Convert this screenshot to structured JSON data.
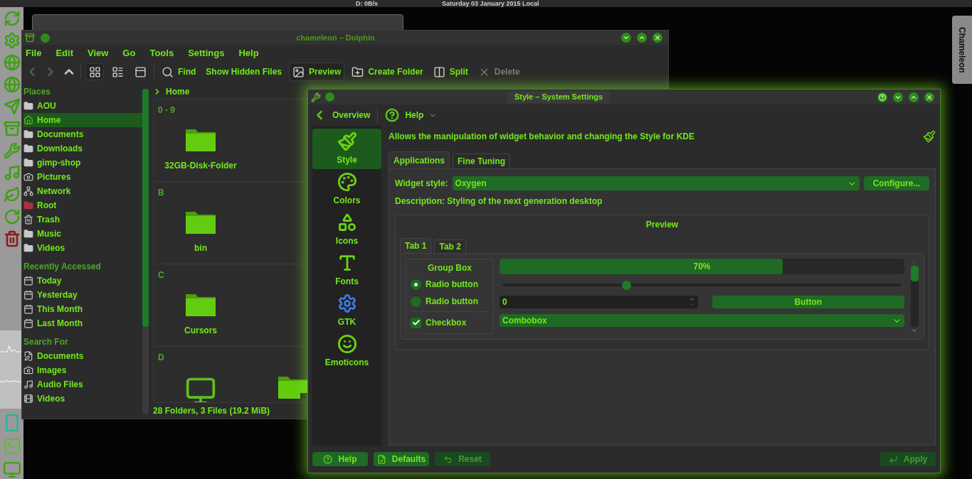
{
  "top_panel": {
    "network_speed": "D: 0B/s",
    "clock": "Saturday 03 January 2015 Local"
  },
  "side_tab": {
    "label": "Chameleon"
  },
  "dolphin": {
    "title": "chameleon – Dolphin",
    "menu": [
      "File",
      "Edit",
      "View",
      "Go",
      "Tools",
      "Settings",
      "Help"
    ],
    "nav": [
      {
        "kind": "back",
        "disabled": true
      },
      {
        "kind": "forward",
        "disabled": true
      },
      {
        "kind": "up",
        "disabled": false
      }
    ],
    "view_modes": [
      {
        "kind": "icons",
        "selected": true
      },
      {
        "kind": "compact",
        "selected": false
      },
      {
        "kind": "details",
        "selected": false
      }
    ],
    "actions": [
      {
        "label": "Find",
        "kind": "find",
        "selected": false,
        "disabled": false
      },
      {
        "label": "Show Hidden Files",
        "kind": "text",
        "selected": false,
        "disabled": false
      },
      {
        "label": "Preview",
        "kind": "preview",
        "selected": true,
        "disabled": false
      },
      {
        "label": "Create Folder",
        "kind": "create",
        "selected": false,
        "disabled": false
      },
      {
        "label": "Split",
        "kind": "split",
        "selected": false,
        "disabled": false
      },
      {
        "label": "Delete",
        "kind": "delete",
        "selected": false,
        "disabled": true
      }
    ],
    "sections": [
      {
        "title": "Places",
        "items": [
          {
            "label": "AOU",
            "kind": "folder",
            "selected": false
          },
          {
            "label": "Home",
            "kind": "home",
            "selected": true
          },
          {
            "label": "Documents",
            "kind": "folder",
            "selected": false
          },
          {
            "label": "Downloads",
            "kind": "folder",
            "selected": false
          },
          {
            "label": "gimp-shop",
            "kind": "folder",
            "selected": false
          },
          {
            "label": "Pictures",
            "kind": "camera",
            "selected": false
          },
          {
            "label": "Network",
            "kind": "network",
            "selected": false
          },
          {
            "label": "Root",
            "kind": "root",
            "selected": false
          },
          {
            "label": "Trash",
            "kind": "trash",
            "selected": false
          },
          {
            "label": "Music",
            "kind": "folder",
            "selected": false
          },
          {
            "label": "Videos",
            "kind": "folder",
            "selected": false
          }
        ]
      },
      {
        "title": "Recently Accessed",
        "items": [
          {
            "label": "Today",
            "kind": "calendar",
            "selected": false
          },
          {
            "label": "Yesterday",
            "kind": "calendar",
            "selected": false
          },
          {
            "label": "This Month",
            "kind": "calendar",
            "selected": false
          },
          {
            "label": "Last Month",
            "kind": "calendar",
            "selected": false
          }
        ]
      },
      {
        "title": "Search For",
        "items": [
          {
            "label": "Documents",
            "kind": "edit",
            "selected": false
          },
          {
            "label": "Images",
            "kind": "camera",
            "selected": false
          },
          {
            "label": "Audio Files",
            "kind": "music",
            "selected": false
          },
          {
            "label": "Videos",
            "kind": "film",
            "selected": false
          }
        ]
      }
    ],
    "breadcrumb": "Home",
    "groups": [
      {
        "letter": "0 - 9",
        "items": [
          {
            "name": "32GB-Disk-Folder",
            "kind": "folder"
          }
        ]
      },
      {
        "letter": "B",
        "items": [
          {
            "name": "bin",
            "kind": "folder"
          }
        ]
      },
      {
        "letter": "C",
        "items": [
          {
            "name": "Cursors",
            "kind": "folder"
          }
        ]
      },
      {
        "letter": "D",
        "items": [
          {
            "kind": "monitor"
          },
          {
            "kind": "folder-link"
          }
        ]
      }
    ],
    "status": "28 Folders, 3 Files (19.2 MiB)"
  },
  "settings": {
    "title": "Style – System Settings",
    "toolbar": [
      {
        "label": "Overview",
        "kind": "back"
      },
      {
        "label": "Help",
        "kind": "help"
      }
    ],
    "categories": [
      {
        "label": "Style",
        "kind": "style",
        "selected": true
      },
      {
        "label": "Colors",
        "kind": "colors",
        "selected": false
      },
      {
        "label": "Icons",
        "kind": "icons",
        "selected": false
      },
      {
        "label": "Fonts",
        "kind": "fonts",
        "selected": false
      },
      {
        "label": "GTK",
        "kind": "gtk",
        "selected": false
      },
      {
        "label": "Emoticons",
        "kind": "emoticons",
        "selected": false
      }
    ],
    "heading": "Allows the manipulation of widget behavior and changing the Style for KDE",
    "tabs": [
      {
        "label": "Applications",
        "selected": true
      },
      {
        "label": "Fine Tuning",
        "selected": false
      }
    ],
    "widget_style": {
      "label": "Widget style:",
      "value": "Oxygen",
      "button": "Configure..."
    },
    "description": "Description: Styling of the next generation desktop",
    "preview": {
      "title": "Preview",
      "tabs": [
        {
          "label": "Tab 1",
          "selected": true
        },
        {
          "label": "Tab 2",
          "selected": false
        }
      ],
      "group_box": "Group Box",
      "radios": [
        {
          "label": "Radio button",
          "selected": true
        },
        {
          "label": "Radio button",
          "selected": false
        }
      ],
      "checkbox": {
        "label": "Checkbox",
        "checked": true
      },
      "progress": {
        "level": 0.7,
        "text": "70%"
      },
      "slider": {
        "level": 0.31
      },
      "spinbox": "0",
      "button": "Button",
      "combobox": "Combobox"
    },
    "buttons": [
      {
        "label": "Help",
        "kind": "help",
        "disabled": false
      },
      {
        "label": "Defaults",
        "kind": "defaults",
        "disabled": false
      },
      {
        "label": "Reset",
        "kind": "reset",
        "disabled": true
      },
      {
        "label": "Apply",
        "kind": "apply",
        "disabled": true
      }
    ]
  }
}
